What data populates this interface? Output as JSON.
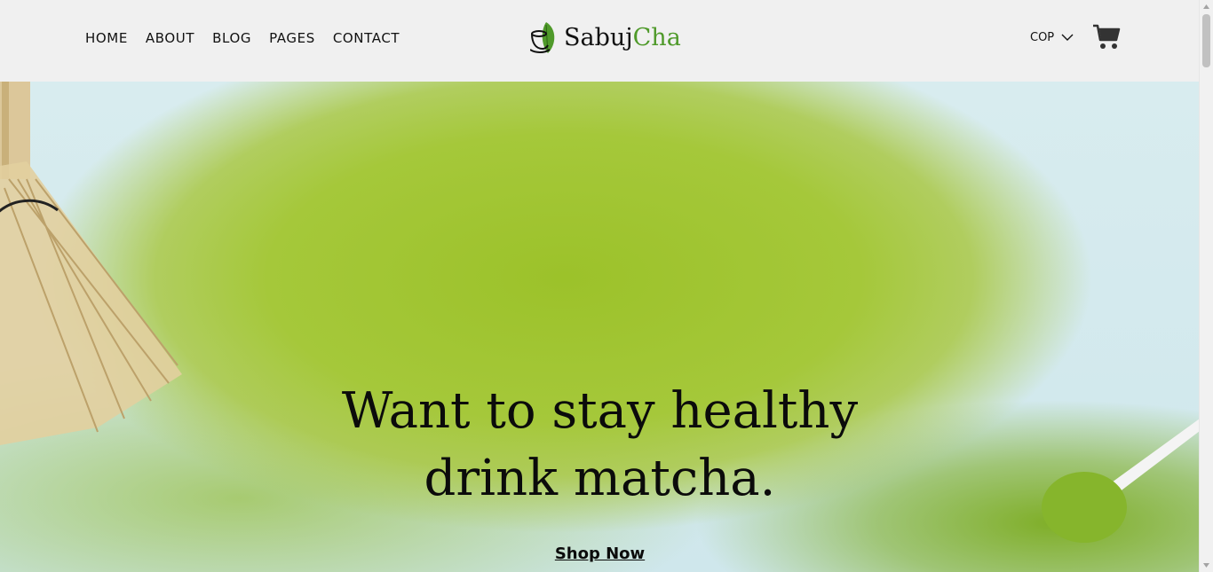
{
  "header": {
    "nav": [
      "HOME",
      "ABOUT",
      "BLOG",
      "PAGES",
      "CONTACT"
    ],
    "logo": {
      "part1": "Sabuj",
      "part2": "Cha"
    },
    "currency": "COP",
    "icons": {
      "currency_chevron": "chevron-down-icon",
      "cart": "cart-icon",
      "logo": "tea-cup-leaf-icon"
    }
  },
  "hero": {
    "line1": "Want to stay healthy",
    "line2": "drink matcha.",
    "cta": "Shop Now"
  },
  "colors": {
    "brand_green": "#4f9a2a",
    "text": "#0b0b0b",
    "header_bg": "#f0f0f0"
  }
}
